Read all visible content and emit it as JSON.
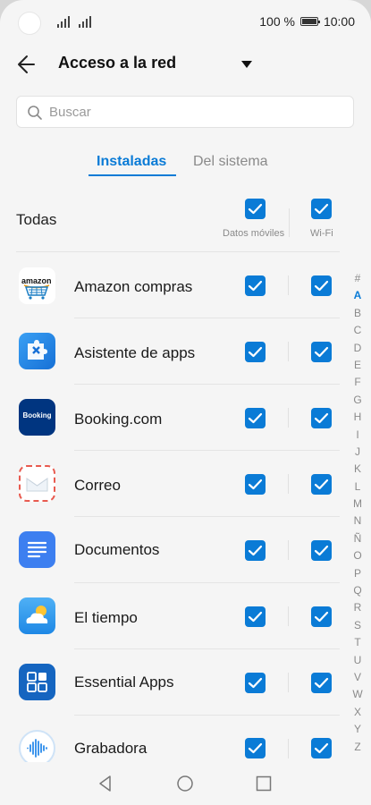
{
  "status": {
    "battery_text": "100 %",
    "time": "10:00"
  },
  "header": {
    "title": "Acceso a la red"
  },
  "search": {
    "placeholder": "Buscar"
  },
  "tabs": [
    {
      "label": "Instaladas",
      "active": true
    },
    {
      "label": "Del sistema",
      "active": false
    }
  ],
  "all_row": {
    "label": "Todas",
    "mobile_label": "Datos móviles",
    "wifi_label": "Wi-Fi",
    "mobile_checked": true,
    "wifi_checked": true
  },
  "apps": [
    {
      "name": "Amazon compras",
      "icon": "amazon-icon",
      "icon_text": "amazon",
      "mobile": true,
      "wifi": true
    },
    {
      "name": "Asistente de apps",
      "icon": "puzzle-icon",
      "mobile": true,
      "wifi": true
    },
    {
      "name": "Booking.com",
      "icon": "booking-icon",
      "icon_text": "Booking",
      "mobile": true,
      "wifi": true
    },
    {
      "name": "Correo",
      "icon": "envelope-icon",
      "mobile": true,
      "wifi": true
    },
    {
      "name": "Documentos",
      "icon": "document-icon",
      "mobile": true,
      "wifi": true
    },
    {
      "name": "El tiempo",
      "icon": "weather-icon",
      "mobile": true,
      "wifi": true
    },
    {
      "name": "Essential Apps",
      "icon": "apps-grid-icon",
      "mobile": true,
      "wifi": true
    },
    {
      "name": "Grabadora",
      "icon": "recorder-icon",
      "mobile": true,
      "wifi": true
    }
  ],
  "index_letters": [
    "#",
    "A",
    "B",
    "C",
    "D",
    "E",
    "F",
    "G",
    "H",
    "I",
    "J",
    "K",
    "L",
    "M",
    "N",
    "Ñ",
    "O",
    "P",
    "Q",
    "R",
    "S",
    "T",
    "U",
    "V",
    "W",
    "X",
    "Y",
    "Z"
  ],
  "index_active": "A",
  "colors": {
    "accent": "#0a7bd6",
    "background": "#f5f5f5"
  }
}
